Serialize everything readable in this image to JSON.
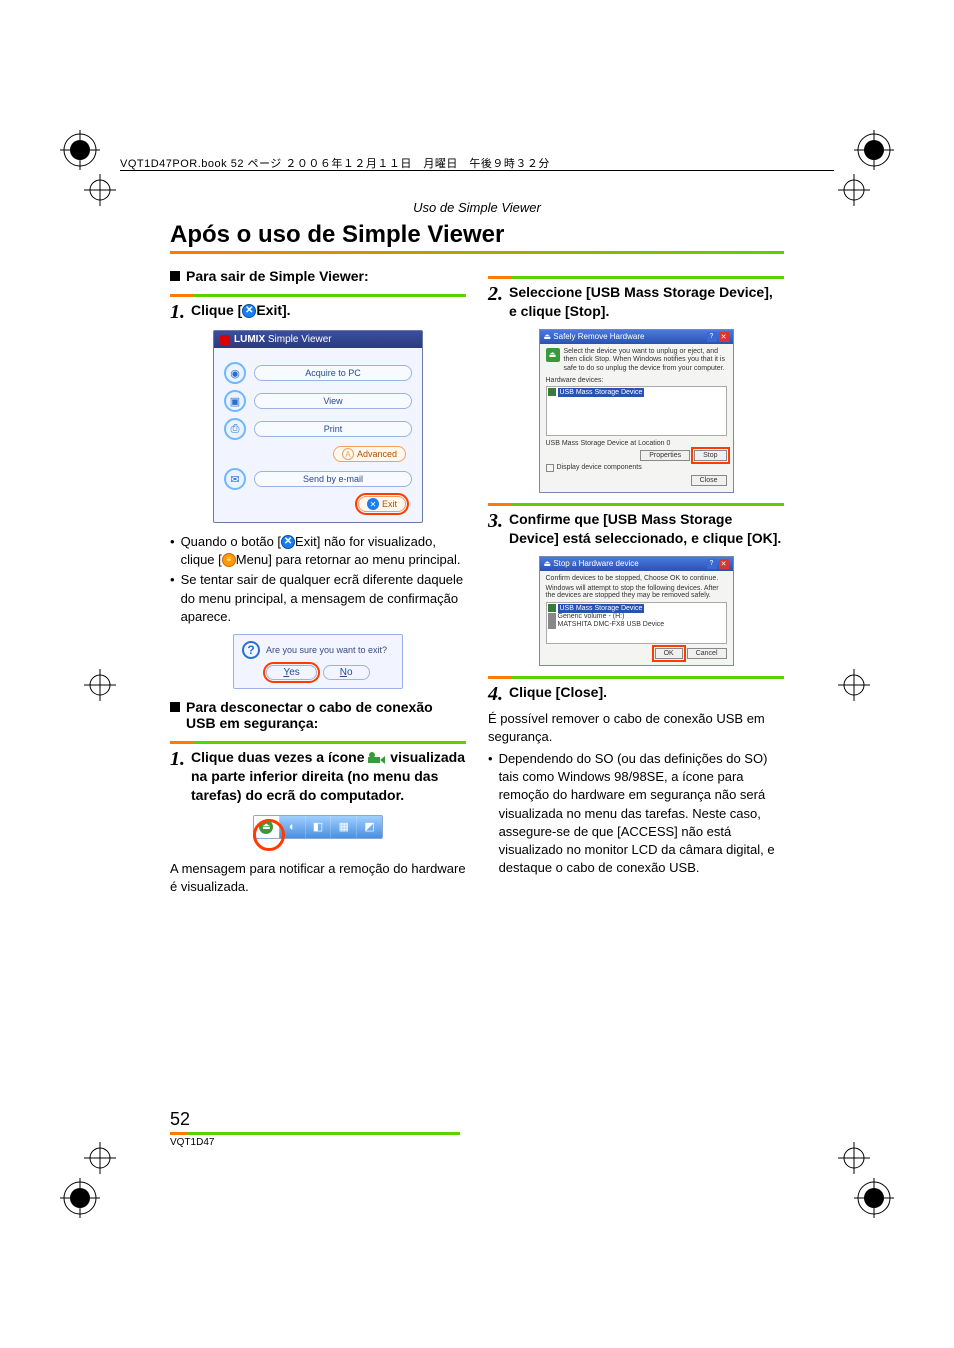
{
  "header_line": "VQT1D47POR.book  52 ページ  ２００６年１２月１１日　月曜日　午後９時３２分",
  "section_label": "Uso de Simple Viewer",
  "main_title": "Após o uso de Simple Viewer",
  "left": {
    "sub1": "Para sair de Simple Viewer:",
    "step1": {
      "num": "1.",
      "text_a": "Clique [",
      "text_b": "Exit]."
    },
    "app": {
      "title_prefix": "LUMIX",
      "title_rest": "Simple Viewer",
      "rows": [
        "Acquire to PC",
        "View",
        "Print",
        "Send by e-mail"
      ],
      "advanced": "Advanced",
      "exit": "Exit"
    },
    "bullet1_a": "Quando o botão [",
    "bullet1_b": "Exit] não for visualizado, clique [",
    "bullet1_c": "Menu] para retornar ao menu principal.",
    "bullet2": "Se tentar sair de qualquer ecrã diferente daquele do menu principal, a mensagem de confirmação aparece.",
    "confirm": {
      "text": "Are you sure you want to exit?",
      "yes": "Yes",
      "no": "No"
    },
    "sub2": "Para desconectar o cabo de conexão USB em segurança:",
    "stepA": {
      "num": "1.",
      "text": "Clique duas vezes a ícone visualizada na parte inferior direita (no menu das tarefas) do ecrã do computador."
    },
    "stepA_text_before_icon": "Clique duas vezes a ícone",
    "stepA_text_after_icon": "visualizada na parte inferior direita (no menu das tarefas) do ecrã do computador.",
    "note1": "A mensagem para notificar a remoção do hardware é visualizada."
  },
  "right": {
    "step2": {
      "num": "2.",
      "text": "Seleccione [USB Mass Storage Device], e clique [Stop]."
    },
    "dlg1": {
      "title": "Safely Remove Hardware",
      "desc": "Select the device you want to unplug or eject, and then click Stop. When Windows notifies you that it is safe to do so unplug the device from your computer.",
      "label": "Hardware devices:",
      "item": "USB Mass Storage Device",
      "loc": "USB Mass Storage Device at Location 0",
      "properties": "Properties",
      "stop": "Stop",
      "display": "Display device components",
      "close": "Close"
    },
    "step3": {
      "num": "3.",
      "text": "Confirme que [USB Mass Storage Device] está seleccionado, e clique [OK]."
    },
    "dlg2": {
      "title": "Stop a Hardware device",
      "desc1": "Confirm devices to be stopped, Choose OK to continue.",
      "desc2": "Windows will attempt to stop the following devices. After the devices are stopped they may be removed safely.",
      "item1": "USB Mass Storage Device",
      "item2": "Generic volume - (H:)",
      "item3": "MATSHITA DMC-FX8 USB Device",
      "ok": "OK",
      "cancel": "Cancel"
    },
    "step4": {
      "num": "4.",
      "text": "Clique [Close]."
    },
    "body4": "É possível remover o cabo de conexão USB em segurança.",
    "bullet4": "Dependendo do SO (ou das definições do SO) tais como Windows 98/98SE, a ícone para remoção do hardware em segurança não será visualizada no menu das tarefas. Neste caso, assegure-se de que [ACCESS] não está visualizado no monitor LCD da câmara digital, e destaque o cabo de conexão USB."
  },
  "page_number": "52",
  "page_code": "VQT1D47"
}
